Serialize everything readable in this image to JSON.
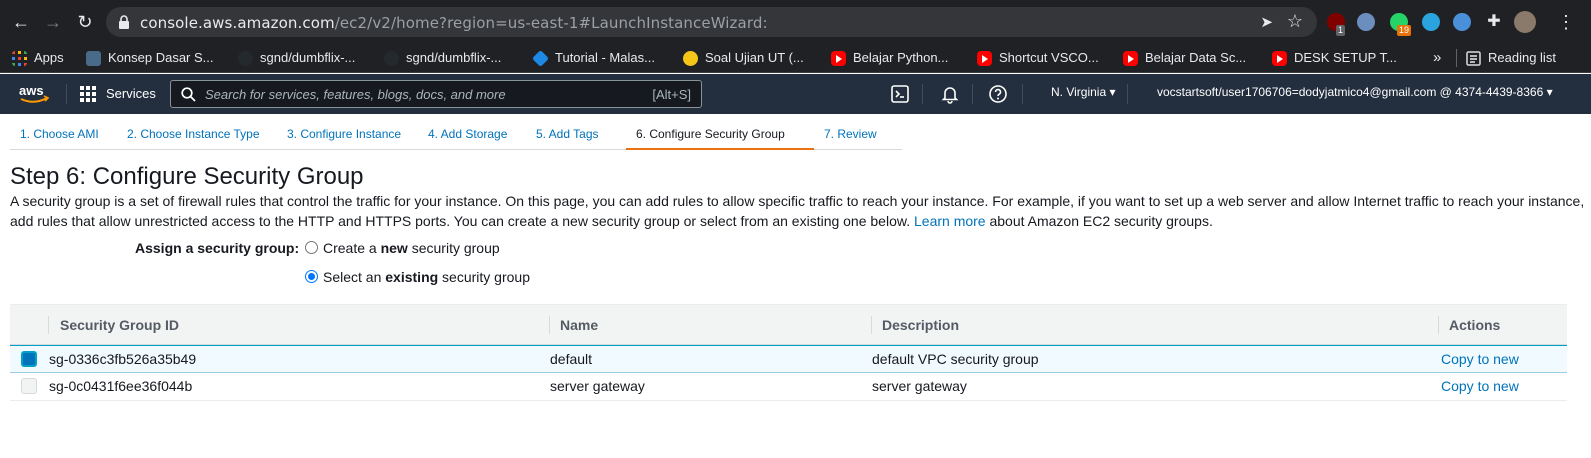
{
  "browser": {
    "url_host": "console.aws.amazon.com",
    "url_path": "/ec2/v2/home?region=us-east-1#LaunchInstanceWizard:",
    "extensions": [
      {
        "name": "ublock",
        "color": "#800000",
        "badge": "1",
        "badge_color": "#5f6368"
      },
      {
        "name": "blocked",
        "color": "#6c8ebf",
        "badge": "",
        "badge_color": ""
      },
      {
        "name": "chat",
        "color": "#25d366",
        "badge": "19",
        "badge_color": "#e8710a"
      },
      {
        "name": "telegram",
        "color": "#2aa3df",
        "badge": "",
        "badge_color": ""
      },
      {
        "name": "face",
        "color": "#4a90d9",
        "badge": "",
        "badge_color": ""
      }
    ]
  },
  "bookmarks": {
    "apps": "Apps",
    "items": [
      "Konsep Dasar S...",
      "sgnd/dumbflix-...",
      "sgnd/dumbflix-...",
      "Tutorial - Malas...",
      "Soal Ujian UT (...",
      "Belajar Python...",
      "Shortcut VSCO...",
      "Belajar Data Sc...",
      "DESK SETUP T..."
    ],
    "more": "»",
    "reading_list": "Reading list"
  },
  "aws": {
    "logo": "aws",
    "services_label": "Services",
    "search_placeholder": "Search for services, features, blogs, docs, and more",
    "search_shortcut": "[Alt+S]",
    "region": "N. Virginia",
    "account": "vocstartsoft/user1706706=dodyjatmico4@gmail.com @ 4374-4439-8366"
  },
  "wizard": {
    "tabs": [
      "1. Choose AMI",
      "2. Choose Instance Type",
      "3. Configure Instance",
      "4. Add Storage",
      "5. Add Tags",
      "6. Configure Security Group",
      "7. Review"
    ],
    "active_tab": 5,
    "title": "Step 6: Configure Security Group",
    "description_1": "A security group is a set of firewall rules that control the traffic for your instance. On this page, you can add rules to allow specific traffic to reach your instance. For example, if you want to set up a web server and allow Internet traffic to reach your instance, add rules that allow unrestricted access to the HTTP and HTTPS ports. You can create a new security group or select from an existing one below.",
    "learn_more": "Learn more",
    "description_2": "about Amazon EC2 security groups.",
    "assign_label": "Assign a security group:",
    "option_new": {
      "pre": "Create a ",
      "bold": "new",
      "post": " security group"
    },
    "option_existing": {
      "pre": "Select an ",
      "bold": "existing",
      "post": " security group"
    }
  },
  "table": {
    "headers": [
      "Security Group ID",
      "Name",
      "Description",
      "Actions"
    ],
    "rows": [
      {
        "id": "sg-0336c3fb526a35b49",
        "name": "default",
        "description": "default VPC security group",
        "action": "Copy to new",
        "selected": true
      },
      {
        "id": "sg-0c0431f6ee36f044b",
        "name": "server gateway",
        "description": "server gateway",
        "action": "Copy to new",
        "selected": false
      }
    ]
  }
}
